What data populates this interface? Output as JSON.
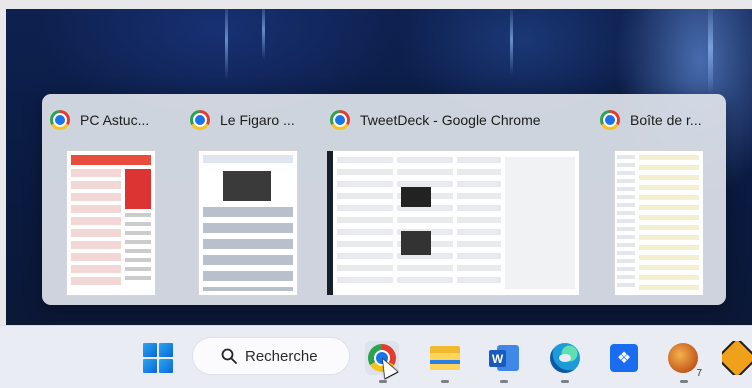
{
  "wallpaper": {
    "description_icon": "desktop-wallpaper"
  },
  "task_view": {
    "windows": [
      {
        "title": "PC Astuc...",
        "icon": "chrome-icon"
      },
      {
        "title": "Le Figaro ...",
        "icon": "chrome-icon"
      },
      {
        "title": "TweetDeck - Google Chrome",
        "icon": "chrome-icon"
      },
      {
        "title": "Boîte de r...",
        "icon": "chrome-icon"
      }
    ]
  },
  "taskbar": {
    "start_icon": "windows-logo-icon",
    "search_label": "Recherche",
    "apps": [
      {
        "name": "chrome",
        "icon": "chrome-icon"
      },
      {
        "name": "file-explorer",
        "icon": "folder-icon"
      },
      {
        "name": "word",
        "icon": "word-icon",
        "letter": "W"
      },
      {
        "name": "edge",
        "icon": "edge-icon"
      },
      {
        "name": "dropbox",
        "icon": "dropbox-icon",
        "glyph": "❖"
      },
      {
        "name": "game",
        "icon": "game-icon",
        "badge": "7"
      },
      {
        "name": "warning",
        "icon": "warning-icon"
      }
    ]
  },
  "colors": {
    "taskbar_bg": "#e9ecf3",
    "flyout_bg": "#dee2ea",
    "accent": "#1a73e8"
  }
}
